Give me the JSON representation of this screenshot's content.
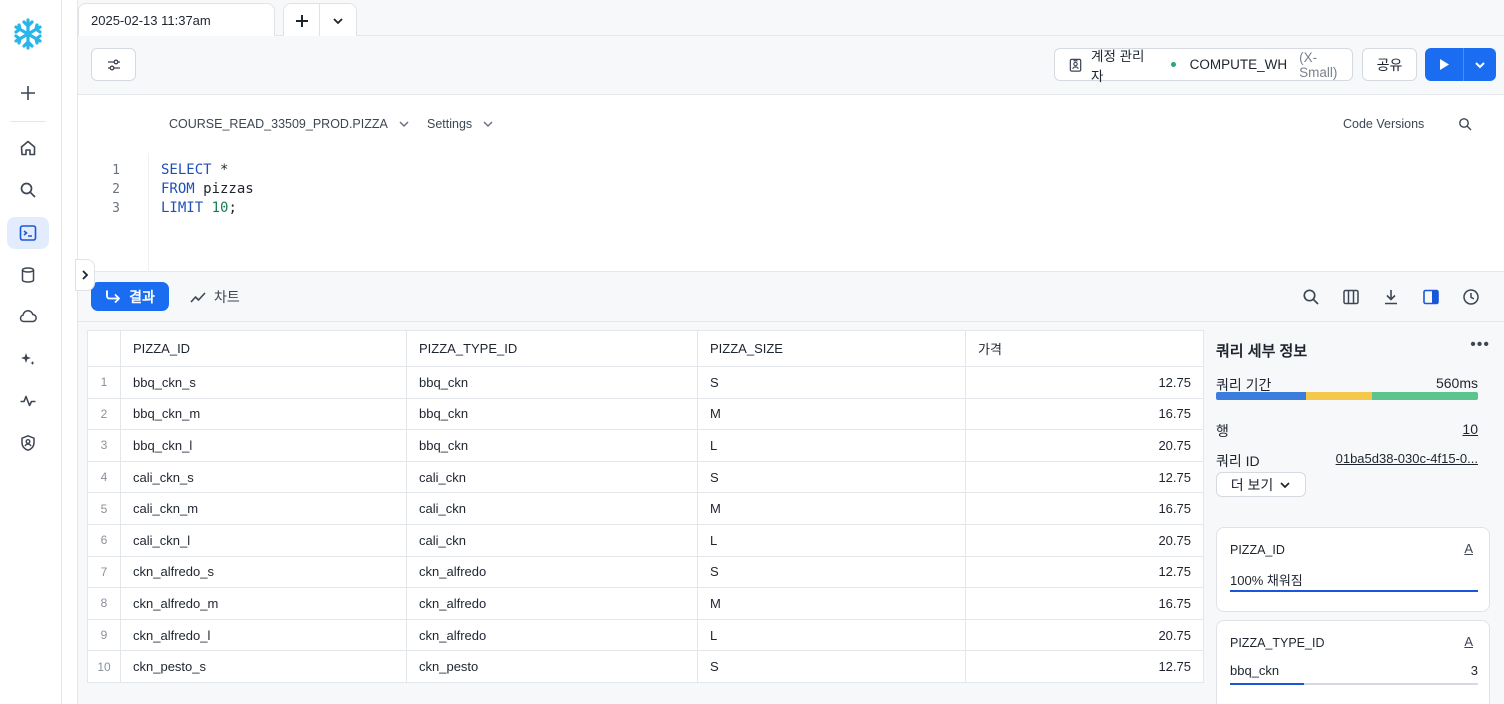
{
  "tab": {
    "title": "2025-02-13 11:37am"
  },
  "toolbar": {
    "role": "계정 관리자",
    "warehouse": "COMPUTE_WH",
    "warehouse_size": "(X-Small)",
    "share": "공유"
  },
  "editor": {
    "context": "COURSE_READ_33509_PROD.PIZZA",
    "settings": "Settings",
    "code_versions": "Code Versions",
    "lines": [
      {
        "n": "1",
        "kw": "SELECT",
        "rest": " *",
        "num": "",
        "tail": ""
      },
      {
        "n": "2",
        "kw": "FROM",
        "rest": " pizzas",
        "num": "",
        "tail": ""
      },
      {
        "n": "3",
        "kw": "LIMIT",
        "rest": " ",
        "num": "10",
        "tail": ";"
      }
    ]
  },
  "results": {
    "tab_results": "결과",
    "tab_chart": "차트",
    "columns": [
      "PIZZA_ID",
      "PIZZA_TYPE_ID",
      "PIZZA_SIZE",
      "가격"
    ],
    "rows": [
      {
        "n": "1",
        "id": "bbq_ckn_s",
        "type": "bbq_ckn",
        "size": "S",
        "price": "12.75"
      },
      {
        "n": "2",
        "id": "bbq_ckn_m",
        "type": "bbq_ckn",
        "size": "M",
        "price": "16.75"
      },
      {
        "n": "3",
        "id": "bbq_ckn_l",
        "type": "bbq_ckn",
        "size": "L",
        "price": "20.75"
      },
      {
        "n": "4",
        "id": "cali_ckn_s",
        "type": "cali_ckn",
        "size": "S",
        "price": "12.75"
      },
      {
        "n": "5",
        "id": "cali_ckn_m",
        "type": "cali_ckn",
        "size": "M",
        "price": "16.75"
      },
      {
        "n": "6",
        "id": "cali_ckn_l",
        "type": "cali_ckn",
        "size": "L",
        "price": "20.75"
      },
      {
        "n": "7",
        "id": "ckn_alfredo_s",
        "type": "ckn_alfredo",
        "size": "S",
        "price": "12.75"
      },
      {
        "n": "8",
        "id": "ckn_alfredo_m",
        "type": "ckn_alfredo",
        "size": "M",
        "price": "16.75"
      },
      {
        "n": "9",
        "id": "ckn_alfredo_l",
        "type": "ckn_alfredo",
        "size": "L",
        "price": "20.75"
      },
      {
        "n": "10",
        "id": "ckn_pesto_s",
        "type": "ckn_pesto",
        "size": "S",
        "price": "12.75"
      }
    ]
  },
  "details": {
    "title": "쿼리 세부 정보",
    "duration_label": "쿼리 기간",
    "duration": "560ms",
    "rows_label": "행",
    "rows": "10",
    "query_id_label": "쿼리 ID",
    "query_id": "01ba5d38-030c-4f15-0...",
    "more": "더 보기",
    "colors": {
      "compile": "#3b7ddd",
      "queue": "#f5c84c",
      "exec": "#5cc48e"
    }
  },
  "cards": [
    {
      "name": "PIZZA_ID",
      "type_icon": "A",
      "label": "100% 채워짐",
      "count": "",
      "fill": 1.0
    },
    {
      "name": "PIZZA_TYPE_ID",
      "type_icon": "A",
      "label": "bbq_ckn",
      "count": "3",
      "fill": 0.3
    }
  ]
}
